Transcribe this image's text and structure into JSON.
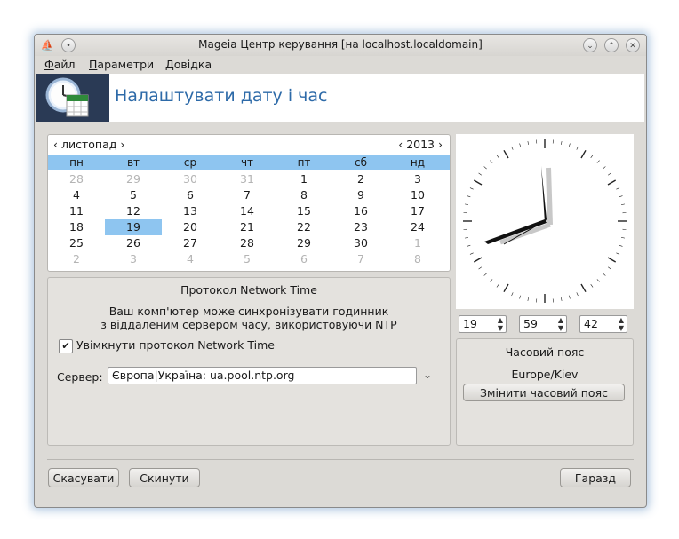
{
  "window": {
    "title": "Mageia Центр керування  [на localhost.localdomain]",
    "buttons": [
      "minimize",
      "maximize",
      "close"
    ]
  },
  "menu": [
    "Файл",
    "Параметри",
    "Довідка"
  ],
  "banner": {
    "title": "Налаштувати дату і час"
  },
  "calendar": {
    "month": "листопад",
    "year": "2013",
    "prev_month": "‹",
    "next_month": "›",
    "prev_year": "‹",
    "next_year": "›",
    "weekdays": [
      "пн",
      "вт",
      "ср",
      "чт",
      "пт",
      "сб",
      "нд"
    ],
    "weeks": [
      [
        {
          "d": "28",
          "m": true
        },
        {
          "d": "29",
          "m": true
        },
        {
          "d": "30",
          "m": true
        },
        {
          "d": "31",
          "m": true
        },
        {
          "d": "1"
        },
        {
          "d": "2"
        },
        {
          "d": "3"
        }
      ],
      [
        {
          "d": "4"
        },
        {
          "d": "5"
        },
        {
          "d": "6"
        },
        {
          "d": "7"
        },
        {
          "d": "8"
        },
        {
          "d": "9"
        },
        {
          "d": "10"
        }
      ],
      [
        {
          "d": "11"
        },
        {
          "d": "12"
        },
        {
          "d": "13"
        },
        {
          "d": "14"
        },
        {
          "d": "15"
        },
        {
          "d": "16"
        },
        {
          "d": "17"
        }
      ],
      [
        {
          "d": "18"
        },
        {
          "d": "19",
          "s": true
        },
        {
          "d": "20"
        },
        {
          "d": "21"
        },
        {
          "d": "22"
        },
        {
          "d": "23"
        },
        {
          "d": "24"
        }
      ],
      [
        {
          "d": "25"
        },
        {
          "d": "26"
        },
        {
          "d": "27"
        },
        {
          "d": "28"
        },
        {
          "d": "29"
        },
        {
          "d": "30"
        },
        {
          "d": "1",
          "m": true
        }
      ],
      [
        {
          "d": "2",
          "m": true
        },
        {
          "d": "3",
          "m": true
        },
        {
          "d": "4",
          "m": true
        },
        {
          "d": "5",
          "m": true
        },
        {
          "d": "6",
          "m": true
        },
        {
          "d": "7",
          "m": true
        },
        {
          "d": "8",
          "m": true
        }
      ]
    ],
    "selected_color": "#8ec5f0"
  },
  "ntp": {
    "title": "Протокол Network Time",
    "description_line1": "Ваш комп'ютер може синхронізувати годинник",
    "description_line2": "з віддаленим сервером часу, використовуючи NTP",
    "enable_label": "Увімкнути протокол Network Time",
    "enabled": true,
    "server_label": "Сервер:",
    "server_value": "Європа|Україна: ua.pool.ntp.org"
  },
  "clock": {
    "hours": "19",
    "minutes": "59",
    "seconds": "42"
  },
  "timezone": {
    "title": "Часовий пояс",
    "value": "Europe/Kiev",
    "change_label": "Змінити часовий пояс"
  },
  "buttons": {
    "cancel": "Скасувати",
    "reset": "Скинути",
    "ok": "Гаразд"
  },
  "icons": {
    "app": "mageia-icon",
    "pin": "pin-icon",
    "banner": "clock-calendar-icon"
  }
}
